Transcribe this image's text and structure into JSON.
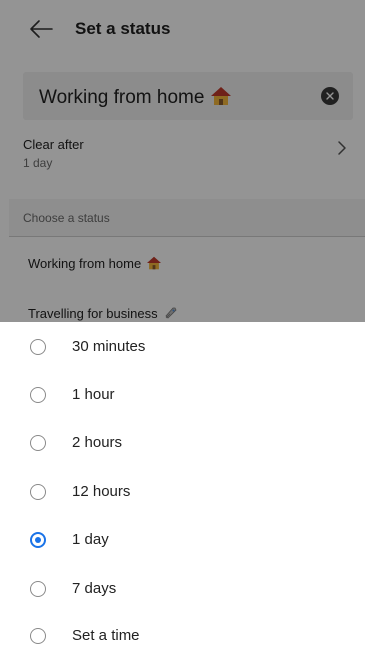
{
  "app_bar": {
    "title": "Set a status"
  },
  "status_field": {
    "value": "Working from home"
  },
  "clear_after": {
    "label": "Clear after",
    "value": "1 day"
  },
  "status_list": {
    "header": "Choose a status",
    "options": [
      {
        "label": "Working from home"
      },
      {
        "label": "Travelling for business"
      }
    ]
  },
  "duration_sheet": {
    "selected": "1 day",
    "options": [
      {
        "label": "30 minutes",
        "checked": false
      },
      {
        "label": "1 hour",
        "checked": false
      },
      {
        "label": "2 hours",
        "checked": false
      },
      {
        "label": "12 hours",
        "checked": false
      },
      {
        "label": "1 day",
        "checked": true
      },
      {
        "label": "7 days",
        "checked": false
      },
      {
        "label": "Set a time",
        "checked": false
      }
    ]
  },
  "colors": {
    "accent": "#1a73e8",
    "scrim": "rgba(0,0,0,0.42)"
  },
  "icons": {
    "back": "arrow-left-icon",
    "clear": "close-circle-icon",
    "chevron": "chevron-right-icon",
    "house": "house-emoji-icon",
    "rocket": "rocket-emoji-icon"
  }
}
